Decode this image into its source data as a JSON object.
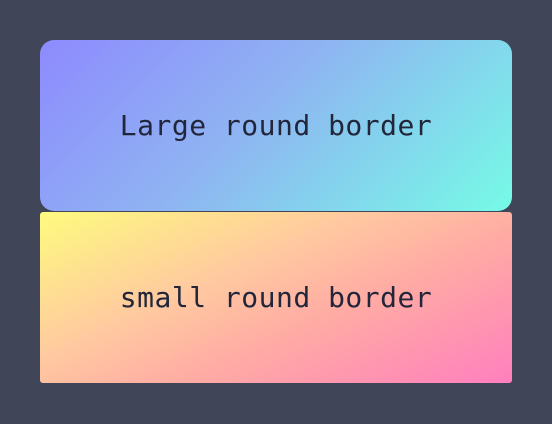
{
  "boxes": {
    "large": {
      "label": "Large round border",
      "gradient_colors": [
        "#8e8afe",
        "#8fb4f2",
        "#76fbe6"
      ]
    },
    "small": {
      "label": "small round border",
      "gradient_colors": [
        "#fefb7e",
        "#ffc9a0",
        "#ffaaa4",
        "#ff7fbe"
      ]
    }
  },
  "colors": {
    "background": "#404558",
    "text": "#22263a"
  }
}
